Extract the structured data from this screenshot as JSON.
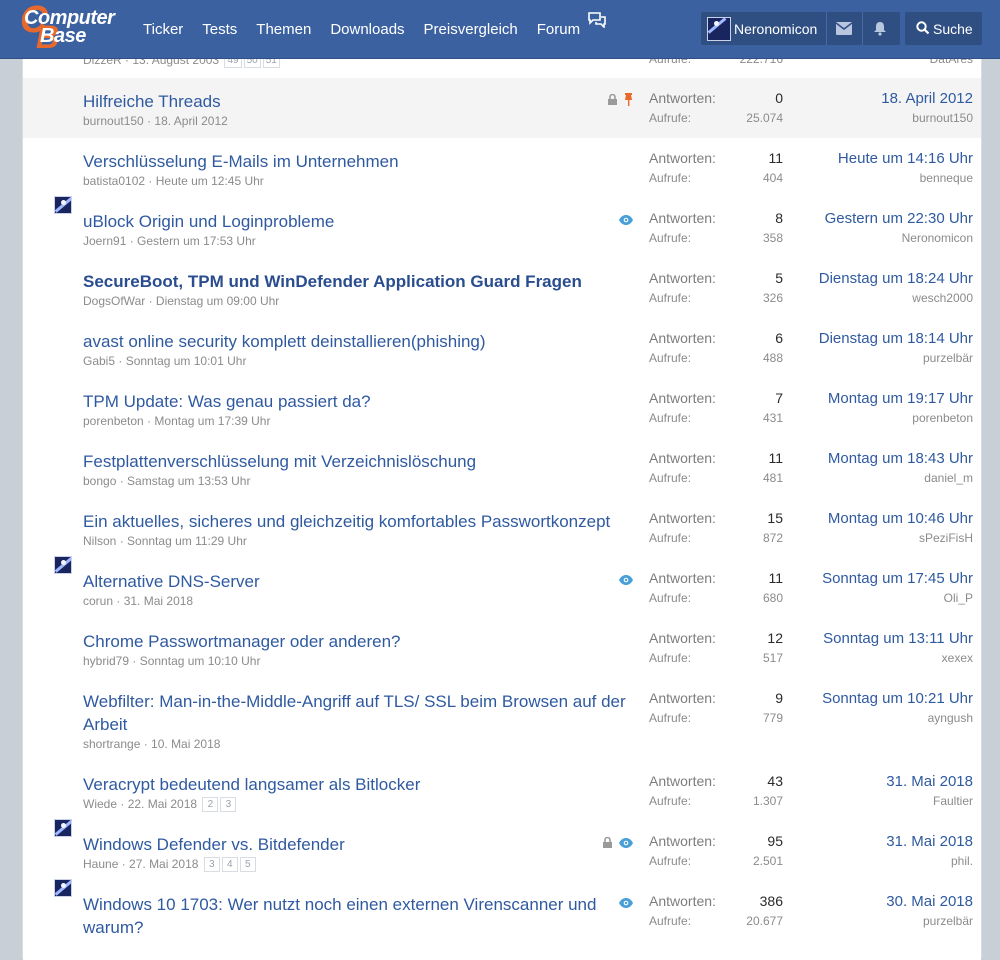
{
  "nav": {
    "logo_line1": "Computer",
    "logo_line2": "Base",
    "links": [
      "Ticker",
      "Tests",
      "Themen",
      "Downloads",
      "Preisvergleich",
      "Forum"
    ],
    "username": "Neronomicon",
    "search_label": "Suche"
  },
  "labels": {
    "answers": "Antworten:",
    "views": "Aufrufe:"
  },
  "top_partial": {
    "author": "DizzeR",
    "date": "13. August 2003",
    "pages": [
      "49",
      "50",
      "51"
    ],
    "views": "222.716",
    "last_user": "DatAres"
  },
  "threads": [
    {
      "title": "Hilfreiche Threads",
      "author": "burnout150",
      "date": "18. April 2012",
      "answers": "0",
      "views": "25.074",
      "last_date": "18. April 2012",
      "last_user": "burnout150"
    },
    {
      "title": "Verschlüsselung E-Mails im Unternehmen",
      "author": "batista0102",
      "date": "Heute um 12:45 Uhr",
      "answers": "11",
      "views": "404",
      "last_date": "Heute um 14:16 Uhr",
      "last_user": "benneque"
    },
    {
      "title": "uBlock Origin und Loginprobleme",
      "author": "Joern91",
      "date": "Gestern um 17:53 Uhr",
      "answers": "8",
      "views": "358",
      "last_date": "Gestern um 22:30 Uhr",
      "last_user": "Neronomicon"
    },
    {
      "title": "SecureBoot, TPM und WinDefender Application Guard Fragen",
      "author": "DogsOfWar",
      "date": "Dienstag um 09:00 Uhr",
      "answers": "5",
      "views": "326",
      "last_date": "Dienstag um 18:24 Uhr",
      "last_user": "wesch2000"
    },
    {
      "title": "avast online security komplett deinstallieren(phishing)",
      "author": "Gabi5",
      "date": "Sonntag um 10:01 Uhr",
      "answers": "6",
      "views": "488",
      "last_date": "Dienstag um 18:14 Uhr",
      "last_user": "purzelbär"
    },
    {
      "title": "TPM Update: Was genau passiert da?",
      "author": "porenbeton",
      "date": "Montag um 17:39 Uhr",
      "answers": "7",
      "views": "431",
      "last_date": "Montag um 19:17 Uhr",
      "last_user": "porenbeton"
    },
    {
      "title": "Festplattenverschlüsselung mit Verzeichnislöschung",
      "author": "bongo",
      "date": "Samstag um 13:53 Uhr",
      "answers": "11",
      "views": "481",
      "last_date": "Montag um 18:43 Uhr",
      "last_user": "daniel_m"
    },
    {
      "title": "Ein aktuelles, sicheres und gleichzeitig komfortables Passwortkonzept",
      "author": "Nilson",
      "date": "Sonntag um 11:29 Uhr",
      "answers": "15",
      "views": "872",
      "last_date": "Montag um 10:46 Uhr",
      "last_user": "sPeziFisH"
    },
    {
      "title": "Alternative DNS-Server",
      "author": "corun",
      "date": "31. Mai 2018",
      "answers": "11",
      "views": "680",
      "last_date": "Sonntag um 17:45 Uhr",
      "last_user": "Oli_P"
    },
    {
      "title": "Chrome Passwortmanager oder anderen?",
      "author": "hybrid79",
      "date": "Sonntag um 10:10 Uhr",
      "answers": "12",
      "views": "517",
      "last_date": "Sonntag um 13:11 Uhr",
      "last_user": "xexex"
    },
    {
      "title_line1": "Webfilter: Man-in-the-Middle-Angriff auf TLS/ SSL beim Browsen auf der",
      "title_line2": "Arbeit",
      "author": "shortrange",
      "date": "10. Mai 2018",
      "answers": "9",
      "views": "779",
      "last_date": "Sonntag um 10:21 Uhr",
      "last_user": "ayngush"
    },
    {
      "title": "Veracrypt bedeutend langsamer als Bitlocker",
      "author": "Wiede",
      "date": "22. Mai 2018",
      "pages": [
        "2",
        "3"
      ],
      "answers": "43",
      "views": "1.307",
      "last_date": "31. Mai 2018",
      "last_user": "Faultier"
    },
    {
      "title": "Windows Defender vs. Bitdefender",
      "author": "Haune",
      "date": "27. Mai 2018",
      "pages": [
        "3",
        "4",
        "5"
      ],
      "answers": "95",
      "views": "2.501",
      "last_date": "31. Mai 2018",
      "last_user": "phil."
    },
    {
      "title_line1": "Windows 10 1703: Wer nutzt noch einen externen Virenscanner und",
      "title_line2": "warum?",
      "answers": "386",
      "views": "20.677",
      "last_date": "30. Mai 2018",
      "last_user": "purzelbär"
    }
  ],
  "colors": {
    "nav_bg": "#3b61a0",
    "link": "#2f5aa0",
    "pin": "#e8692b",
    "watch": "#4a9fd9"
  }
}
